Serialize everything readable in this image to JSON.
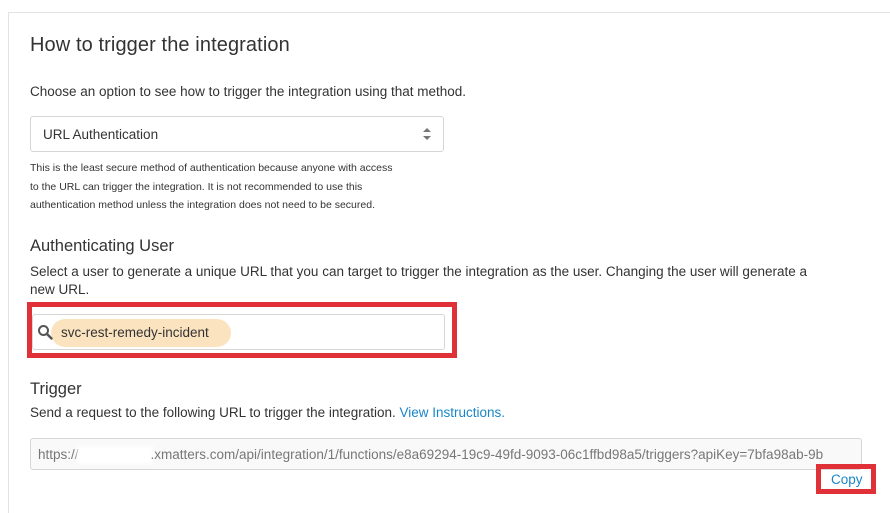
{
  "section": {
    "title": "How to trigger the integration",
    "intro": "Choose an option to see how to trigger the integration using that method."
  },
  "auth_method": {
    "selected": "URL Authentication",
    "help_lines": [
      "This is the least secure method of authentication because anyone with access",
      "to the URL can trigger the integration. It is not recommended to use this",
      "authentication method unless the integration does not need to be secured."
    ]
  },
  "authenticating_user": {
    "heading": "Authenticating User",
    "description_line1": "Select a user to generate a unique URL that you can target to trigger the integration as the user. Changing the user will generate a",
    "description_line2": "new URL.",
    "value": "svc-rest-remedy-incident"
  },
  "trigger": {
    "heading": "Trigger",
    "description": "Send a request to the following URL to trigger the integration.",
    "instructions_link": "View Instructions.",
    "url_prefix": "https://",
    "url_rest": ".xmatters.com/api/integration/1/functions/e8a69294-19c9-49fd-9093-06c1ffbd98a5/triggers?apiKey=7bfa98ab-9b",
    "copy_label": "Copy"
  },
  "colors": {
    "annotation_red": "#e03038",
    "link_blue": "#1a86c8",
    "highlight_orange": "#fbe2bd"
  }
}
